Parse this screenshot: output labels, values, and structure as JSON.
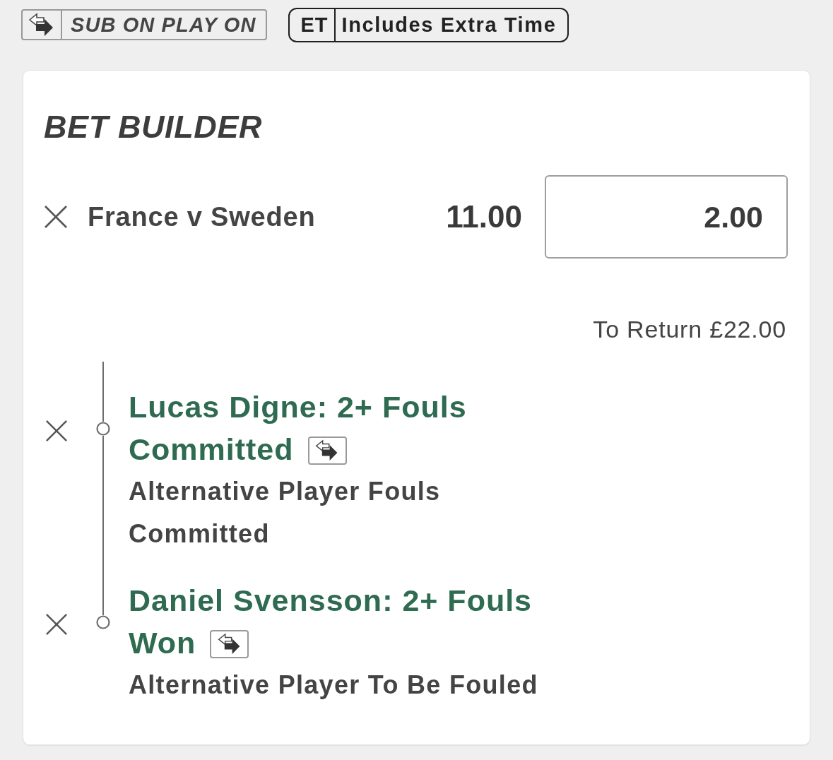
{
  "legend": [
    {
      "kind": "sub_on",
      "label": "SUB ON PLAY ON"
    },
    {
      "kind": "code",
      "code": "ET",
      "label": "Includes Extra Time"
    }
  ],
  "bet_builder": {
    "title": "BET BUILDER",
    "match": {
      "name": "France v Sweden",
      "odds": "11.00",
      "stake": "2.00"
    },
    "to_return": "To Return £22.00",
    "selections": [
      {
        "title": "Lucas Digne: 2+ Fouls Committed",
        "sub_on": true,
        "market": "Alternative Player Fouls Committed"
      },
      {
        "title": "Daniel Svensson: 2+ Fouls Won",
        "sub_on": true,
        "market": "Alternative Player To Be Fouled"
      }
    ]
  }
}
